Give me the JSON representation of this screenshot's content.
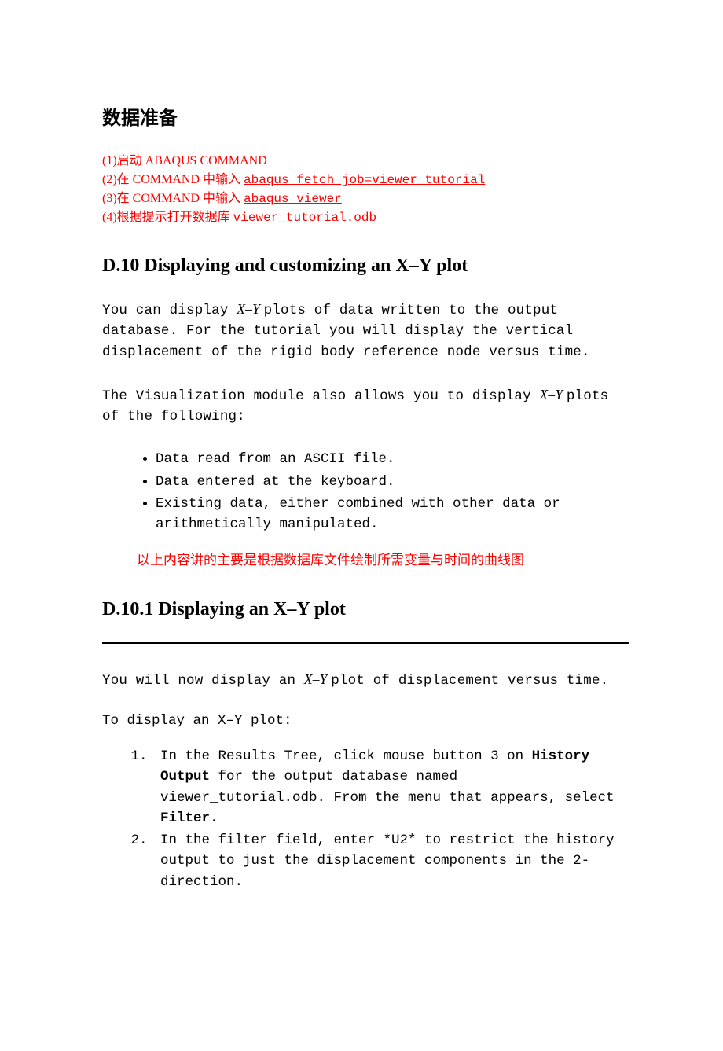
{
  "title": "数据准备",
  "prep": {
    "line1_prefix": "(1)启动 ABAQUS COMMAND",
    "line2_prefix": "(2)在 COMMAND 中输入 ",
    "line2_cmd": "abaqus fetch job=viewer_tutorial",
    "line3_prefix": "(3)在 COMMAND 中输入 ",
    "line3_cmd": "abaqus viewer",
    "line4_prefix": "(4)根据提示打开数据库 ",
    "line4_cmd": "viewer_tutorial.odb"
  },
  "section_d10": {
    "heading": "D.10 Displaying and customizing an X–Y plot",
    "para1_a": "You can display ",
    "para1_xy": "X–Y ",
    "para1_b": "plots of data written to the output database. For the tutorial you will display the vertical displacement of the rigid body reference node versus time.",
    "para2_a": "The Visualization module also allows you to display ",
    "para2_xy": "X–Y ",
    "para2_b": "plots of the following:",
    "bullets": {
      "b1": "Data read from an ASCII file.",
      "b2": "Data entered at the keyboard.",
      "b3": "Existing data, either combined with other data or arithmetically manipulated."
    },
    "red_note": "以上内容讲的主要是根据数据库文件绘制所需变量与时间的曲线图"
  },
  "section_d101": {
    "heading": "D.10.1 Displaying an X–Y plot",
    "para_a": "You will now display an ",
    "para_xy": "X–Y ",
    "para_b": "plot of displacement versus time.",
    "sub": "To display an X–Y plot:",
    "step1_a": "In the Results Tree, click mouse button 3 on ",
    "step1_bold1": "History Output",
    "step1_b": " for the output database named viewer_tutorial.odb. From the menu that appears, select ",
    "step1_bold2": "Filter",
    "step1_c": ".",
    "step2": "In the filter field, enter *U2* to restrict the history output to just the displacement components in the 2-direction."
  }
}
